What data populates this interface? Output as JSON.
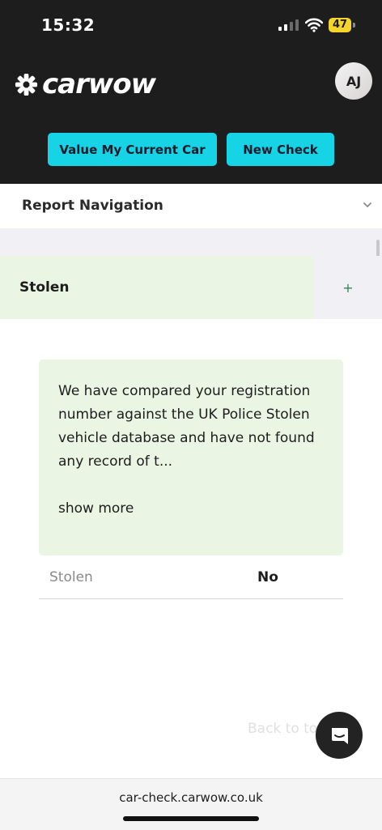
{
  "status_bar": {
    "time": "15:32",
    "battery": "47"
  },
  "brand": {
    "name": "carwow",
    "accent": "#17d3e6"
  },
  "header": {
    "avatar_initials": "AJ",
    "value_button": "Value My Current Car",
    "new_check_button": "New Check"
  },
  "nav": {
    "label": "Report Navigation"
  },
  "section": {
    "title": "Stolen",
    "toggle": "+",
    "info_text": "We have compared your registration number against the UK Police Stolen vehicle database and have not found any record of t...",
    "show_more": "show more",
    "row_label": "Stolen",
    "row_value": "No"
  },
  "back_to_top": "Back to top",
  "browser": {
    "url": "car-check.carwow.co.uk"
  }
}
